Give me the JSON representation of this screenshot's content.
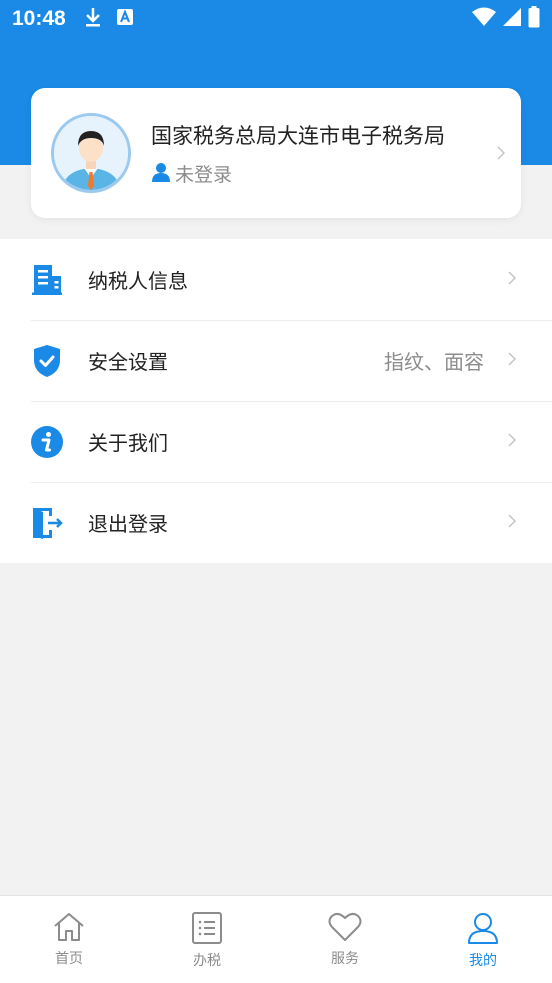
{
  "status_bar": {
    "time": "10:48",
    "icons_left": [
      "download-icon",
      "a-badge-icon"
    ],
    "icons_right": [
      "wifi-icon",
      "signal-icon",
      "battery-icon"
    ]
  },
  "colors": {
    "brand_blue": "#1a8ae6",
    "background": "#f2f2f2",
    "text_primary": "#222222",
    "text_secondary": "#8c8c8c"
  },
  "profile": {
    "name": "国家税务总局大连市电子税务局",
    "login_status": "未登录",
    "avatar_icon": "user-avatar-icon",
    "status_icon": "person-icon"
  },
  "menu": {
    "items": [
      {
        "label": "纳税人信息",
        "value": "",
        "icon": "building-icon"
      },
      {
        "label": "安全设置",
        "value": "指纹、面容",
        "icon": "shield-check-icon"
      },
      {
        "label": "关于我们",
        "value": "",
        "icon": "info-icon"
      },
      {
        "label": "退出登录",
        "value": "",
        "icon": "logout-door-icon"
      }
    ]
  },
  "tabbar": {
    "tabs": [
      {
        "label": "首页",
        "icon": "home-icon",
        "active": false
      },
      {
        "label": "办税",
        "icon": "list-icon",
        "active": false
      },
      {
        "label": "服务",
        "icon": "heart-icon",
        "active": false
      },
      {
        "label": "我的",
        "icon": "user-icon",
        "active": true
      }
    ]
  }
}
